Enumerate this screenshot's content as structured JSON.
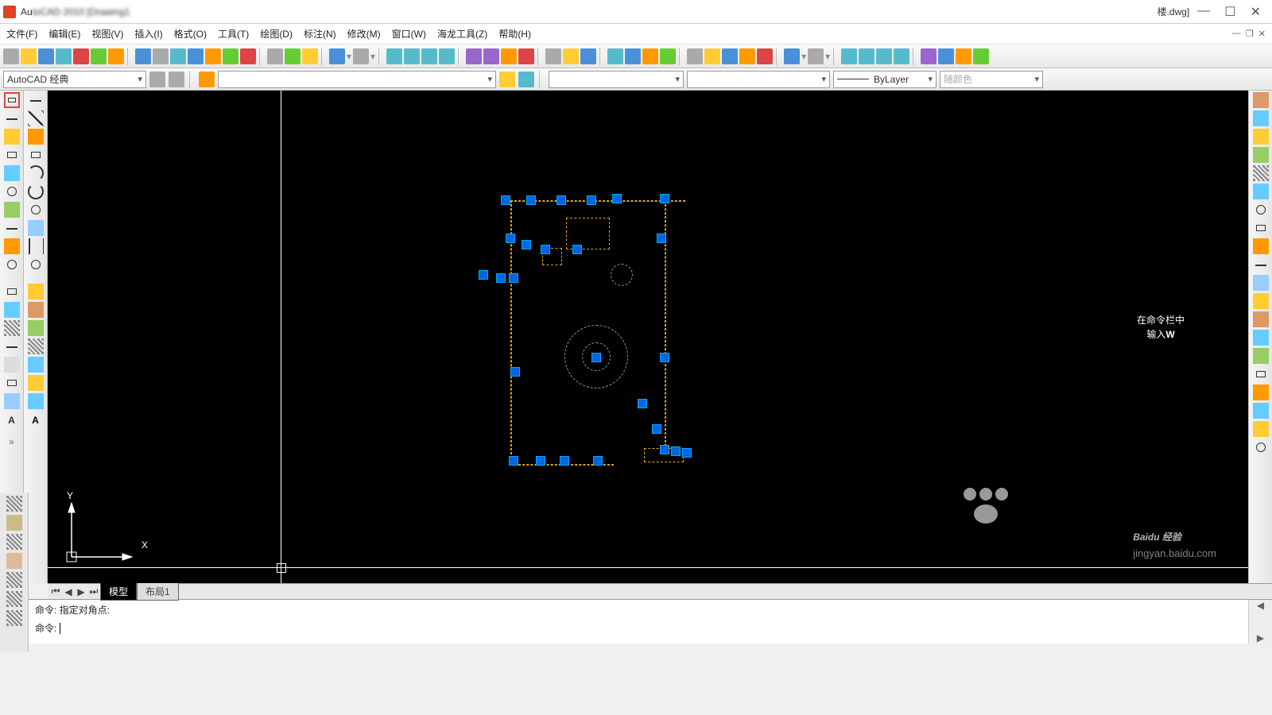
{
  "title": {
    "app": "Au",
    "blurred": "toCAD 2010 [Drawing1",
    "suffix": "楼.dwg]"
  },
  "win": {
    "min": "—",
    "max": "☐",
    "close": "✕"
  },
  "menu": [
    "文件(F)",
    "编辑(E)",
    "视图(V)",
    "插入(I)",
    "格式(O)",
    "工具(T)",
    "绘图(D)",
    "标注(N)",
    "修改(M)",
    "窗口(W)",
    "海龙工具(Z)",
    "帮助(H)"
  ],
  "workspace": "AutoCAD 经典",
  "layerprop": "",
  "linetype": "ByLayer",
  "color_label": "随颜色",
  "tabs": {
    "model": "模型",
    "layout": "布局1"
  },
  "cmd": {
    "line1": "命令: 指定对角点:",
    "line2": "命令: "
  },
  "overlay": {
    "l1": "在命令栏中",
    "l2a": "输入",
    "l2b": "W"
  },
  "watermark": {
    "main": "Baidu 经验",
    "sub": "jingyan.baidu.com"
  },
  "ucs": {
    "x": "X",
    "y": "Y"
  }
}
